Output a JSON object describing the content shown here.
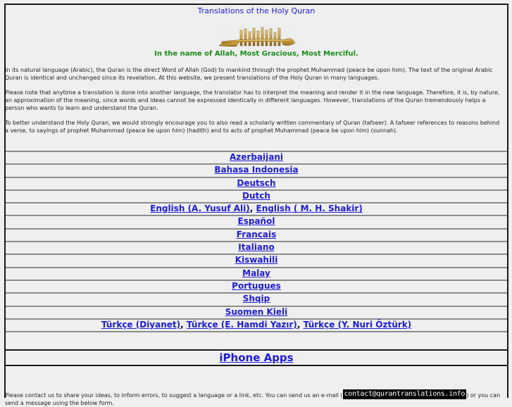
{
  "header": {
    "title": "Translations of the Holy Quran",
    "bismillah_image": "bismillah-calligraphy",
    "subtitle": "In the name of Allah, Most Gracious, Most Merciful."
  },
  "intro": {
    "paragraphs": [
      "In its natural language (Arabic), the Quran is the direct Word of Allah (God) to mankind through the prophet Muhammad (peace be upon him). The text of the original Arabic Quran is identical and unchanged since its revelation. At this website, we present translations of the Holy Quran in many languages.",
      "Please note that anytime a translation is done into another language, the translator has to interpret the meaning and render it in the new language. Therefore, it is, by nature, an approximation of the meaning, since words and ideas cannot be expressed identically in different languages. However, translations of the Quran tremendously helps a person who wants to learn and understand the Quran.",
      "To better understand the Holy Quran, we would strongly encourage you to also read a scholarly written commentary of Quran (tafseer). A tafseer references to reasons behind a verse, to sayings of prophet Muhammad (peace be upon him) (hadith) and to acts of prophet Muhammad (peace be upon him) (sunnah)."
    ]
  },
  "languages": [
    {
      "links": [
        "Azerbaijani"
      ]
    },
    {
      "links": [
        "Bahasa Indonesia"
      ]
    },
    {
      "links": [
        "Deutsch"
      ]
    },
    {
      "links": [
        "Dutch"
      ]
    },
    {
      "links": [
        "English (A. Yusuf Ali)",
        "English ( M. H. Shakir)"
      ]
    },
    {
      "links": [
        "Español"
      ]
    },
    {
      "links": [
        "Francais"
      ]
    },
    {
      "links": [
        "Italiano"
      ]
    },
    {
      "links": [
        "Kiswahili"
      ]
    },
    {
      "links": [
        "Malay"
      ]
    },
    {
      "links": [
        "Portugues"
      ]
    },
    {
      "links": [
        "Shqip"
      ]
    },
    {
      "links": [
        "Suomen Kieli"
      ]
    },
    {
      "links": [
        "Türkçe (Diyanet)",
        "Türkçe (E. Hamdi Yazır)",
        "Türkçe (Y. Nuri Öztürk)"
      ]
    }
  ],
  "link_separator": ", ",
  "iphone": {
    "label": "iPhone Apps"
  },
  "contact": {
    "text_before": "Please contact us to share your ideas, to inform errors, to suggest a language or a link, etc. You can send us an e-mail (",
    "email": "contact@qurantranslations.info",
    "text_after": ") or you can send a message using the below form."
  },
  "colors": {
    "link": "#1c1cd8",
    "subtitle": "#1a8a1a",
    "background": "#efefef"
  }
}
